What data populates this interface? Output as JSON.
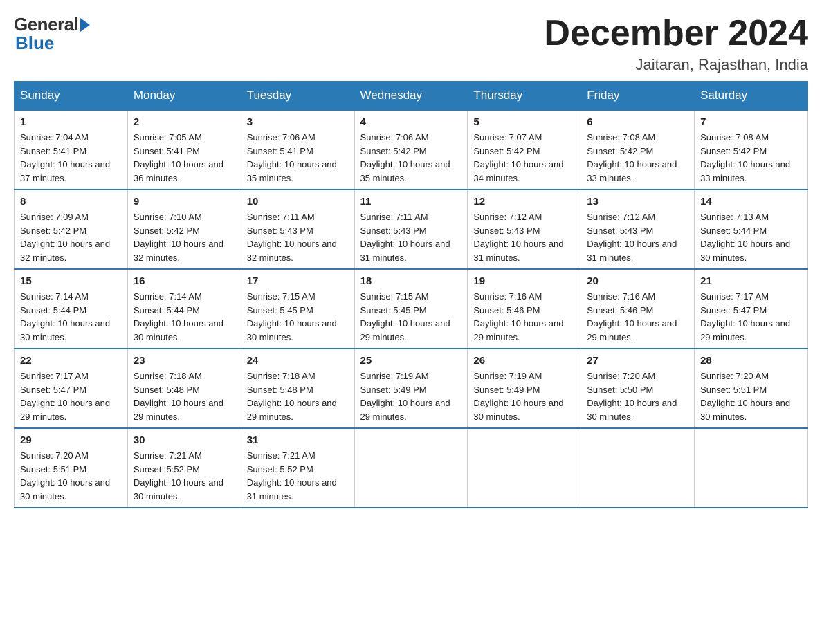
{
  "logo": {
    "general": "General",
    "blue": "Blue"
  },
  "title": "December 2024",
  "location": "Jaitaran, Rajasthan, India",
  "days_of_week": [
    "Sunday",
    "Monday",
    "Tuesday",
    "Wednesday",
    "Thursday",
    "Friday",
    "Saturday"
  ],
  "weeks": [
    [
      {
        "day": "1",
        "sunrise": "7:04 AM",
        "sunset": "5:41 PM",
        "daylight": "10 hours and 37 minutes."
      },
      {
        "day": "2",
        "sunrise": "7:05 AM",
        "sunset": "5:41 PM",
        "daylight": "10 hours and 36 minutes."
      },
      {
        "day": "3",
        "sunrise": "7:06 AM",
        "sunset": "5:41 PM",
        "daylight": "10 hours and 35 minutes."
      },
      {
        "day": "4",
        "sunrise": "7:06 AM",
        "sunset": "5:42 PM",
        "daylight": "10 hours and 35 minutes."
      },
      {
        "day": "5",
        "sunrise": "7:07 AM",
        "sunset": "5:42 PM",
        "daylight": "10 hours and 34 minutes."
      },
      {
        "day": "6",
        "sunrise": "7:08 AM",
        "sunset": "5:42 PM",
        "daylight": "10 hours and 33 minutes."
      },
      {
        "day": "7",
        "sunrise": "7:08 AM",
        "sunset": "5:42 PM",
        "daylight": "10 hours and 33 minutes."
      }
    ],
    [
      {
        "day": "8",
        "sunrise": "7:09 AM",
        "sunset": "5:42 PM",
        "daylight": "10 hours and 32 minutes."
      },
      {
        "day": "9",
        "sunrise": "7:10 AM",
        "sunset": "5:42 PM",
        "daylight": "10 hours and 32 minutes."
      },
      {
        "day": "10",
        "sunrise": "7:11 AM",
        "sunset": "5:43 PM",
        "daylight": "10 hours and 32 minutes."
      },
      {
        "day": "11",
        "sunrise": "7:11 AM",
        "sunset": "5:43 PM",
        "daylight": "10 hours and 31 minutes."
      },
      {
        "day": "12",
        "sunrise": "7:12 AM",
        "sunset": "5:43 PM",
        "daylight": "10 hours and 31 minutes."
      },
      {
        "day": "13",
        "sunrise": "7:12 AM",
        "sunset": "5:43 PM",
        "daylight": "10 hours and 31 minutes."
      },
      {
        "day": "14",
        "sunrise": "7:13 AM",
        "sunset": "5:44 PM",
        "daylight": "10 hours and 30 minutes."
      }
    ],
    [
      {
        "day": "15",
        "sunrise": "7:14 AM",
        "sunset": "5:44 PM",
        "daylight": "10 hours and 30 minutes."
      },
      {
        "day": "16",
        "sunrise": "7:14 AM",
        "sunset": "5:44 PM",
        "daylight": "10 hours and 30 minutes."
      },
      {
        "day": "17",
        "sunrise": "7:15 AM",
        "sunset": "5:45 PM",
        "daylight": "10 hours and 30 minutes."
      },
      {
        "day": "18",
        "sunrise": "7:15 AM",
        "sunset": "5:45 PM",
        "daylight": "10 hours and 29 minutes."
      },
      {
        "day": "19",
        "sunrise": "7:16 AM",
        "sunset": "5:46 PM",
        "daylight": "10 hours and 29 minutes."
      },
      {
        "day": "20",
        "sunrise": "7:16 AM",
        "sunset": "5:46 PM",
        "daylight": "10 hours and 29 minutes."
      },
      {
        "day": "21",
        "sunrise": "7:17 AM",
        "sunset": "5:47 PM",
        "daylight": "10 hours and 29 minutes."
      }
    ],
    [
      {
        "day": "22",
        "sunrise": "7:17 AM",
        "sunset": "5:47 PM",
        "daylight": "10 hours and 29 minutes."
      },
      {
        "day": "23",
        "sunrise": "7:18 AM",
        "sunset": "5:48 PM",
        "daylight": "10 hours and 29 minutes."
      },
      {
        "day": "24",
        "sunrise": "7:18 AM",
        "sunset": "5:48 PM",
        "daylight": "10 hours and 29 minutes."
      },
      {
        "day": "25",
        "sunrise": "7:19 AM",
        "sunset": "5:49 PM",
        "daylight": "10 hours and 29 minutes."
      },
      {
        "day": "26",
        "sunrise": "7:19 AM",
        "sunset": "5:49 PM",
        "daylight": "10 hours and 30 minutes."
      },
      {
        "day": "27",
        "sunrise": "7:20 AM",
        "sunset": "5:50 PM",
        "daylight": "10 hours and 30 minutes."
      },
      {
        "day": "28",
        "sunrise": "7:20 AM",
        "sunset": "5:51 PM",
        "daylight": "10 hours and 30 minutes."
      }
    ],
    [
      {
        "day": "29",
        "sunrise": "7:20 AM",
        "sunset": "5:51 PM",
        "daylight": "10 hours and 30 minutes."
      },
      {
        "day": "30",
        "sunrise": "7:21 AM",
        "sunset": "5:52 PM",
        "daylight": "10 hours and 30 minutes."
      },
      {
        "day": "31",
        "sunrise": "7:21 AM",
        "sunset": "5:52 PM",
        "daylight": "10 hours and 31 minutes."
      },
      null,
      null,
      null,
      null
    ]
  ]
}
